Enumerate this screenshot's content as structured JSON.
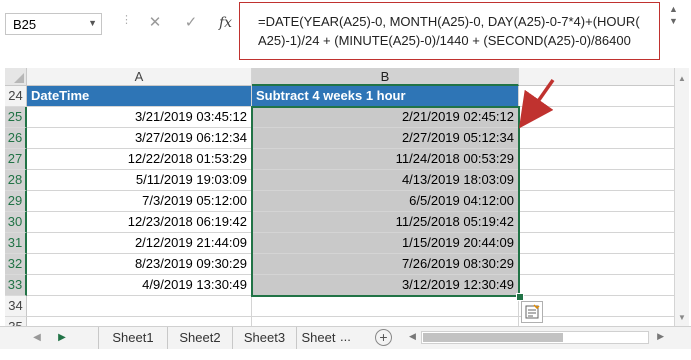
{
  "formula_bar": {
    "cell_ref": "B25",
    "cancel_icon": "✕",
    "enter_icon": "✓",
    "fx_label": "fx",
    "formula_line1": "=DATE(YEAR(A25)-0, MONTH(A25)-0, DAY(A25)-0-7*4)+(HOUR(",
    "formula_line2": "A25)-1)/24 + (MINUTE(A25)-0)/1440 + (SECOND(A25)-0)/86400"
  },
  "columns": [
    "A",
    "B"
  ],
  "selected_column": "B",
  "header_row": {
    "row": "24",
    "a": "DateTime",
    "b": "Subtract 4 weeks 1 hour"
  },
  "rows": [
    {
      "row": "25",
      "a": "3/21/2019 03:45:12",
      "b": "2/21/2019 02:45:12"
    },
    {
      "row": "26",
      "a": "3/27/2019 06:12:34",
      "b": "2/27/2019 05:12:34"
    },
    {
      "row": "27",
      "a": "12/22/2018 01:53:29",
      "b": "11/24/2018 00:53:29"
    },
    {
      "row": "28",
      "a": "5/11/2019 19:03:09",
      "b": "4/13/2019 18:03:09"
    },
    {
      "row": "29",
      "a": "7/3/2019 05:12:00",
      "b": "6/5/2019 04:12:00"
    },
    {
      "row": "30",
      "a": "12/23/2018 06:19:42",
      "b": "11/25/2018 05:19:42"
    },
    {
      "row": "31",
      "a": "2/12/2019 21:44:09",
      "b": "1/15/2019 20:44:09"
    },
    {
      "row": "32",
      "a": "8/23/2019 09:30:29",
      "b": "7/26/2019 08:30:29"
    },
    {
      "row": "33",
      "a": "4/9/2019 13:30:49",
      "b": "3/12/2019 12:30:49"
    }
  ],
  "empty_rows": [
    "34",
    "35"
  ],
  "sheet_tabs": [
    "Sheet1",
    "Sheet2",
    "Sheet3",
    "Sheet"
  ],
  "tab_more": "...",
  "add_sheet": "+",
  "colors": {
    "header_blue": "#2e75b6",
    "result_gray": "#c9c9c9",
    "excel_green": "#217346",
    "annotation_red": "#c0322f"
  }
}
